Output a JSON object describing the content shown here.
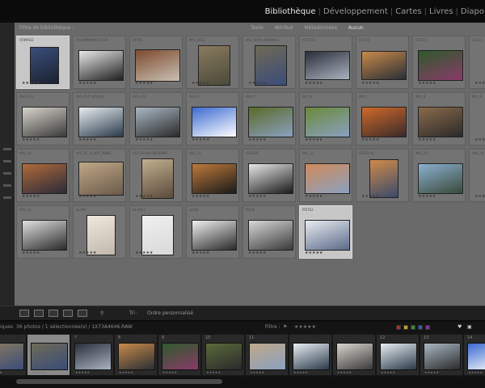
{
  "modules": [
    "Bibliothèque",
    "Développement",
    "Cartes",
    "Livres",
    "Diapo"
  ],
  "module_active": "Bibliothèque",
  "filter_bar": {
    "label": "Filtre de bibliothèque :",
    "options": [
      "Texte",
      "Attribut",
      "Métadonnées",
      "Aucun"
    ],
    "active": "Aucun"
  },
  "grid": {
    "cells": [
      {
        "name": "ATIMAGE",
        "selected": true,
        "thumb": {
          "w": 34,
          "h": 44,
          "c": "#3a4d7a",
          "c2": "#1b2130"
        }
      },
      {
        "name": "ATCOMMUNICATION",
        "selected": false,
        "thumb": {
          "w": 54,
          "h": 36,
          "c": "#e8e8e8",
          "c2": "#202020"
        }
      },
      {
        "name": "SKYPE",
        "selected": false,
        "thumb": {
          "w": 54,
          "h": 38,
          "c": "#7d4a2e",
          "c2": "#c9c0b3"
        }
      },
      {
        "name": "IMG_3012",
        "selected": false,
        "thumb": {
          "w": 38,
          "h": 48,
          "c": "#8a7a5f",
          "c2": "#4a4a3a"
        }
      },
      {
        "name": "IMG_3040_APSIIMAG",
        "selected": false,
        "thumb": {
          "w": 38,
          "h": 48,
          "c": "#6e6a55",
          "c2": "#3a4d7a"
        }
      },
      {
        "name": "ATCCOS",
        "selected": false,
        "thumb": {
          "w": 54,
          "h": 34,
          "c": "#2a2f3a",
          "c2": "#aab3c0"
        }
      },
      {
        "name": "DSCF2",
        "selected": false,
        "thumb": {
          "w": 54,
          "h": 34,
          "c": "#c98a4a",
          "c2": "#2a2e35"
        }
      },
      {
        "name": "DSCF3",
        "selected": false,
        "thumb": {
          "w": 54,
          "h": 36,
          "c": "#2e5a2a",
          "c2": "#8a3a6a"
        }
      },
      {
        "name": "DSCF4",
        "selected": false,
        "thumb": {
          "w": 14,
          "h": 36,
          "c": "#5a6a3a",
          "c2": "#2a2a2a"
        }
      },
      {
        "name": "IMG_001",
        "selected": false,
        "thumb": {
          "w": 54,
          "h": 36,
          "c": "#d8d4cc",
          "c2": "#3a3a3a"
        }
      },
      {
        "name": "IMG_OUT_BOUGE",
        "selected": false,
        "thumb": {
          "w": 54,
          "h": 36,
          "c": "#e8eef2",
          "c2": "#2a3a4a"
        }
      },
      {
        "name": "IMG_201",
        "selected": false,
        "thumb": {
          "w": 54,
          "h": 36,
          "c": "#aab8c4",
          "c2": "#2a2a2a"
        }
      },
      {
        "name": "IMG_4",
        "selected": false,
        "thumb": {
          "w": 54,
          "h": 36,
          "c": "#3a6ad0",
          "c2": "#ffffff"
        }
      },
      {
        "name": "IMG_5",
        "selected": false,
        "thumb": {
          "w": 54,
          "h": 36,
          "c": "#5a6a2a",
          "c2": "#8aa0c0"
        }
      },
      {
        "name": "IMG_6",
        "selected": false,
        "thumb": {
          "w": 54,
          "h": 36,
          "c": "#6a8a3a",
          "c2": "#8aa0c0"
        }
      },
      {
        "name": "IMG_7",
        "selected": false,
        "thumb": {
          "w": 54,
          "h": 36,
          "c": "#d06a2a",
          "c2": "#3a2a2a"
        }
      },
      {
        "name": "IMG_8",
        "selected": false,
        "thumb": {
          "w": 54,
          "h": 36,
          "c": "#8a6a4a",
          "c2": "#2a2a2a"
        }
      },
      {
        "name": "IMG_9",
        "selected": false,
        "thumb": {
          "w": 14,
          "h": 36,
          "c": "#3a4a2a",
          "c2": "#2a2a2a"
        }
      },
      {
        "name": "IMG_10",
        "selected": false,
        "thumb": {
          "w": 54,
          "h": 36,
          "c": "#b06a3a",
          "c2": "#2a2a3a"
        }
      },
      {
        "name": "IMG_SC_ACHAT_ANNE",
        "selected": false,
        "thumb": {
          "w": 54,
          "h": 40,
          "c": "#c0a888",
          "c2": "#6a5a4a"
        }
      },
      {
        "name": "IMG_SCAN_ANCIENNE",
        "selected": false,
        "thumb": {
          "w": 38,
          "h": 48,
          "c": "#c0b090",
          "c2": "#5a4a3a"
        }
      },
      {
        "name": "IMG_11",
        "selected": false,
        "thumb": {
          "w": 54,
          "h": 36,
          "c": "#c07a3a",
          "c2": "#1a1a1a"
        }
      },
      {
        "name": "ATACHE",
        "selected": false,
        "thumb": {
          "w": 54,
          "h": 36,
          "c": "#e8e8e8",
          "c2": "#1a1a1a"
        }
      },
      {
        "name": "IMG_12",
        "selected": false,
        "thumb": {
          "w": 54,
          "h": 36,
          "c": "#d08a5a",
          "c2": "#8aa0c0"
        }
      },
      {
        "name": "VERTICAL",
        "selected": false,
        "thumb": {
          "w": 34,
          "h": 46,
          "c": "#d08a4a",
          "c2": "#3a4a6a"
        }
      },
      {
        "name": "IMG_13",
        "selected": false,
        "thumb": {
          "w": 54,
          "h": 36,
          "c": "#8ab0d0",
          "c2": "#3a4a3a"
        }
      },
      {
        "name": "IMG_14",
        "selected": false,
        "thumb": {
          "w": 14,
          "h": 36,
          "c": "#5a8ab0",
          "c2": "#2a2a2a"
        }
      },
      {
        "name": "IMG_15",
        "selected": false,
        "thumb": {
          "w": 54,
          "h": 36,
          "c": "#e0e0e0",
          "c2": "#2a2a2a"
        }
      },
      {
        "name": "BLANC",
        "selected": false,
        "thumb": {
          "w": 34,
          "h": 48,
          "c": "#f0e8dc",
          "c2": "#c0b8ac"
        }
      },
      {
        "name": "BLANC2",
        "selected": false,
        "thumb": {
          "w": 38,
          "h": 48,
          "c": "#f0f0f0",
          "c2": "#d8d8d8"
        }
      },
      {
        "name": "LIGNE",
        "selected": false,
        "thumb": {
          "w": 54,
          "h": 36,
          "c": "#f0f0f0",
          "c2": "#2a2a2a"
        }
      },
      {
        "name": "PISTE",
        "selected": false,
        "thumb": {
          "w": 54,
          "h": 36,
          "c": "#d8d8d8",
          "c2": "#3a3a3a"
        }
      },
      {
        "name": "PISTE2",
        "selected": true,
        "thumb": {
          "w": 54,
          "h": 36,
          "c": "#e8ecf0",
          "c2": "#5a6a8a"
        }
      }
    ],
    "star_label": "★★★★★"
  },
  "toolbar": {
    "sort_label": "Tri :",
    "sort_value": "Ordre personnalisé"
  },
  "statusbar": {
    "left": "iques",
    "count": "36 photos / 1 sélectionnée(s) / 1X73A4646.RAW",
    "filter_label": "Filtre :",
    "colors": [
      "#b02a2a",
      "#c0a02a",
      "#3a8a3a",
      "#3a5ab0",
      "#7a3a9a"
    ]
  },
  "filmstrip": {
    "cells": [
      {
        "num": "",
        "c": "#8a7a5f",
        "c2": "#3a4d7a",
        "selected": false
      },
      {
        "num": "6",
        "c": "#6e6a55",
        "c2": "#3a4d7a",
        "selected": true
      },
      {
        "num": "7",
        "c": "#2a2f3a",
        "c2": "#aab3c0",
        "selected": false
      },
      {
        "num": "8",
        "c": "#c98a4a",
        "c2": "#2a2e35",
        "selected": false
      },
      {
        "num": "9",
        "c": "#2e5a2a",
        "c2": "#8a3a6a",
        "selected": false
      },
      {
        "num": "10",
        "c": "#5a6a3a",
        "c2": "#2a2a2a",
        "selected": false
      },
      {
        "num": "11",
        "c": "#c0a888",
        "c2": "#8aa0c0",
        "selected": false
      },
      {
        "num": "",
        "c": "#e8eef2",
        "c2": "#2a3a4a",
        "selected": false
      },
      {
        "num": "",
        "c": "#d8d4cc",
        "c2": "#3a3a3a",
        "selected": false
      },
      {
        "num": "12",
        "c": "#e8eef2",
        "c2": "#2a3a4a",
        "selected": false
      },
      {
        "num": "13",
        "c": "#aab8c4",
        "c2": "#2a2a2a",
        "selected": false
      },
      {
        "num": "14",
        "c": "#3a6ad0",
        "c2": "#ffffff",
        "selected": false
      },
      {
        "num": "15",
        "c": "#5a6a2a",
        "c2": "#8aa0c0",
        "selected": false
      }
    ],
    "star_label": "★★★★★"
  }
}
